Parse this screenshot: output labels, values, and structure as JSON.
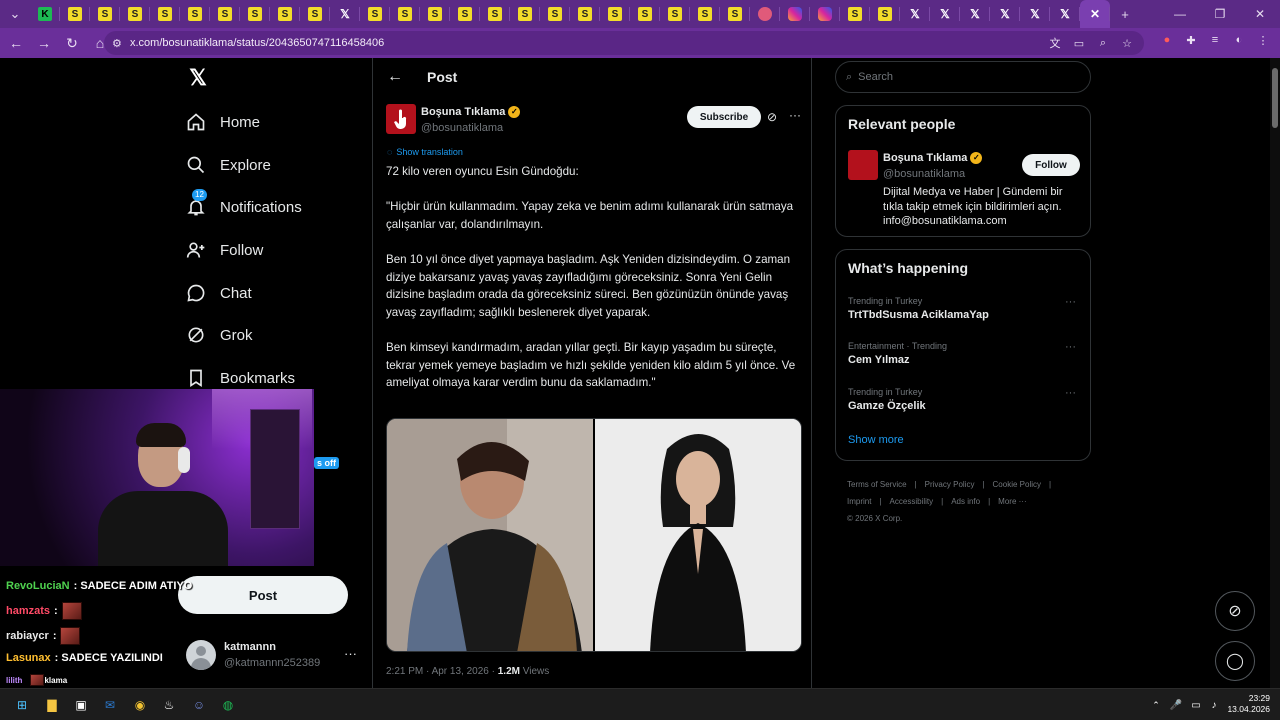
{
  "browser": {
    "tabs_count": 37,
    "url": "x.com/bosunatiklama/status/2043650747116458406"
  },
  "sidebar": {
    "items": [
      {
        "label": "Home"
      },
      {
        "label": "Explore"
      },
      {
        "label": "Notifications",
        "badge": "12"
      },
      {
        "label": "Follow"
      },
      {
        "label": "Chat"
      },
      {
        "label": "Grok"
      },
      {
        "label": "Bookmarks"
      }
    ],
    "post_button": "Post",
    "teaser_badge": "s off",
    "account": {
      "name": "katmannn",
      "handle": "@katmannn252389"
    }
  },
  "post": {
    "header_title": "Post",
    "author_name": "Boşuna Tıklama",
    "author_handle": "@bosunatiklama",
    "subscribe_label": "Subscribe",
    "show_translation": "Show translation",
    "paragraphs": [
      "72 kilo veren oyuncu Esin Gündoğdu:",
      "\"Hiçbir ürün kullanmadım. Yapay zeka ve benim adımı kullanarak ürün satmaya çalışanlar var, dolandırılmayın.",
      "Ben 10 yıl önce diyet yapmaya başladım. Aşk Yeniden dizisindeydim. O zaman diziye bakarsanız yavaş yavaş zayıfladığımı göreceksiniz. Sonra Yeni Gelin dizisine başladım orada da göreceksiniz süreci. Ben gözünüzün önünde yavaş yavaş zayıfladım; sağlıklı beslenerek diyet yaparak.",
      "Ben kimseyi kandırmadım, aradan yıllar geçti. Bir kayıp yaşadım bu süreçte, tekrar yemek yemeye başladım ve hızlı şekilde yeniden kilo aldım 5 yıl önce. Ve ameliyat olmaya karar verdim bunu da saklamadım.\""
    ],
    "meta_time": "2:21 PM · Apr 13, 2026 · ",
    "meta_views_count": "1.2M",
    "meta_views_label": " Views"
  },
  "right": {
    "search_placeholder": "Search",
    "relevant_title": "Relevant people",
    "relevant_person": {
      "name": "Boşuna Tıklama",
      "handle": "@bosunatiklama",
      "bio": "Dijital Medya ve Haber | Gündemi bir tıkla takip etmek için bildirimleri açın. info@bosunatiklama.com",
      "follow_label": "Follow"
    },
    "happening_title": "What’s happening",
    "trends": [
      {
        "context": "Trending in Turkey",
        "title": "TrtTbdSusma AciklamaYap"
      },
      {
        "context": "Entertainment · Trending",
        "title": "Cem Yılmaz"
      },
      {
        "context": "Trending in Turkey",
        "title": "Gamze Özçelik"
      }
    ],
    "show_more": "Show more",
    "footer": [
      "Terms of Service",
      "|",
      "Privacy Policy",
      "|",
      "Cookie Policy",
      "|",
      "Imprint",
      "|",
      "Accessibility",
      "|",
      "Ads info",
      "|",
      "More ···",
      "© 2026 X Corp."
    ]
  },
  "chat": [
    {
      "user": "RevoLuciaN",
      "color": "#4fd24f",
      "text": "SADECE ADIM ATIYO"
    },
    {
      "user": "hamzats",
      "color": "#ff4a66",
      "text": ""
    },
    {
      "user": "rabiaycr",
      "color": "#e9e9e9",
      "text": ""
    },
    {
      "user": "Lasunax",
      "color": "#ffbf30",
      "text": "SADECE YAZILINDI"
    },
    {
      "user": "lilith",
      "color": "#c08bff",
      "text": "klama"
    }
  ],
  "taskbar": {
    "time": "23:29",
    "date": "13.04.2026"
  }
}
